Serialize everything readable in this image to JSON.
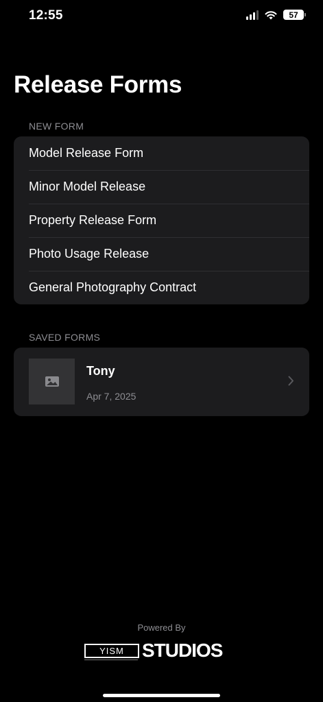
{
  "status_bar": {
    "time": "12:55",
    "battery": "57"
  },
  "header": {
    "title": "Release Forms"
  },
  "new_form": {
    "section_label": "NEW FORM",
    "items": [
      {
        "label": "Model Release Form"
      },
      {
        "label": "Minor Model Release"
      },
      {
        "label": "Property Release Form"
      },
      {
        "label": "Photo Usage Release"
      },
      {
        "label": "General Photography Contract"
      }
    ]
  },
  "saved_forms": {
    "section_label": "SAVED FORMS",
    "items": [
      {
        "name": "Tony",
        "date": "Apr 7, 2025",
        "thumbnail_icon": "image-placeholder-icon"
      }
    ]
  },
  "footer": {
    "powered_by": "Powered By",
    "logo_box_text": "YISM",
    "logo_word": "STUDIOS"
  },
  "colors": {
    "background": "#000000",
    "card": "#1c1c1e",
    "secondary_text": "#8e8e93"
  }
}
